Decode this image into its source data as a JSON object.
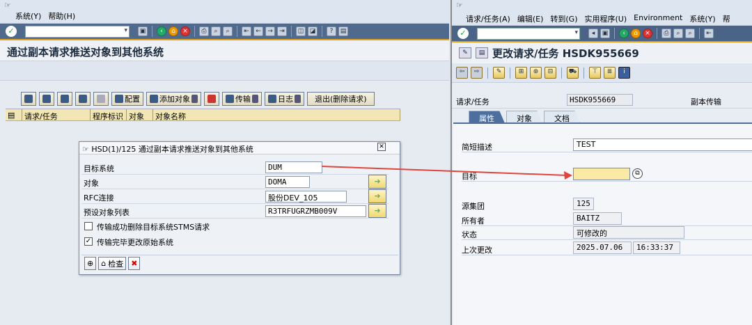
{
  "left_window": {
    "menu": [
      "系统(Y)",
      "帮助(H)"
    ],
    "title": "通过副本请求推送对象到其他系统",
    "buttons": {
      "config": "配置",
      "add_object": "添加对象",
      "transport": "传输",
      "log": "日志",
      "exit": "退出(删除请求)"
    },
    "columns": [
      "请求/任务",
      "程序标识",
      "对象",
      "对象名称"
    ],
    "dialog": {
      "title": "HSD(1)/125 通过副本请求推送对象到其他系统",
      "fields": [
        {
          "label": "目标系统",
          "value": "DUM"
        },
        {
          "label": "对象",
          "value": "DOMA"
        },
        {
          "label": "RFC连接",
          "value": "股份DEV_105"
        },
        {
          "label": "预设对象列表",
          "value": "R3TRFUGRZMB009V"
        }
      ],
      "checkboxes": [
        {
          "label": "传输成功删除目标系统STMS请求",
          "checked": false
        },
        {
          "label": "传输完毕更改原始系统",
          "checked": true
        }
      ],
      "check_button": "检查"
    }
  },
  "right_window": {
    "menu": [
      "请求/任务(A)",
      "编辑(E)",
      "转到(G)",
      "实用程序(U)",
      "Environment",
      "系统(Y)",
      "帮"
    ],
    "title": "更改请求/任务 HSDK955669",
    "request_label": "请求/任务",
    "request_value": "HSDK955669",
    "request_type": "副本传输",
    "tabs": [
      "属性",
      "对象",
      "文档"
    ],
    "fields": {
      "short_desc_label": "简短描述",
      "short_desc_value": "TEST",
      "target_label": "目标",
      "target_value": "",
      "source_client_label": "源集团",
      "source_client_value": "125",
      "owner_label": "所有者",
      "owner_value": "BAITZ",
      "status_label": "状态",
      "status_value": "可修改的",
      "last_changed_label": "上次更改",
      "last_changed_date": "2025.07.06",
      "last_changed_time": "16:33:37"
    }
  },
  "accent_color": "#e0a020",
  "arrow_color": "#e0443a"
}
